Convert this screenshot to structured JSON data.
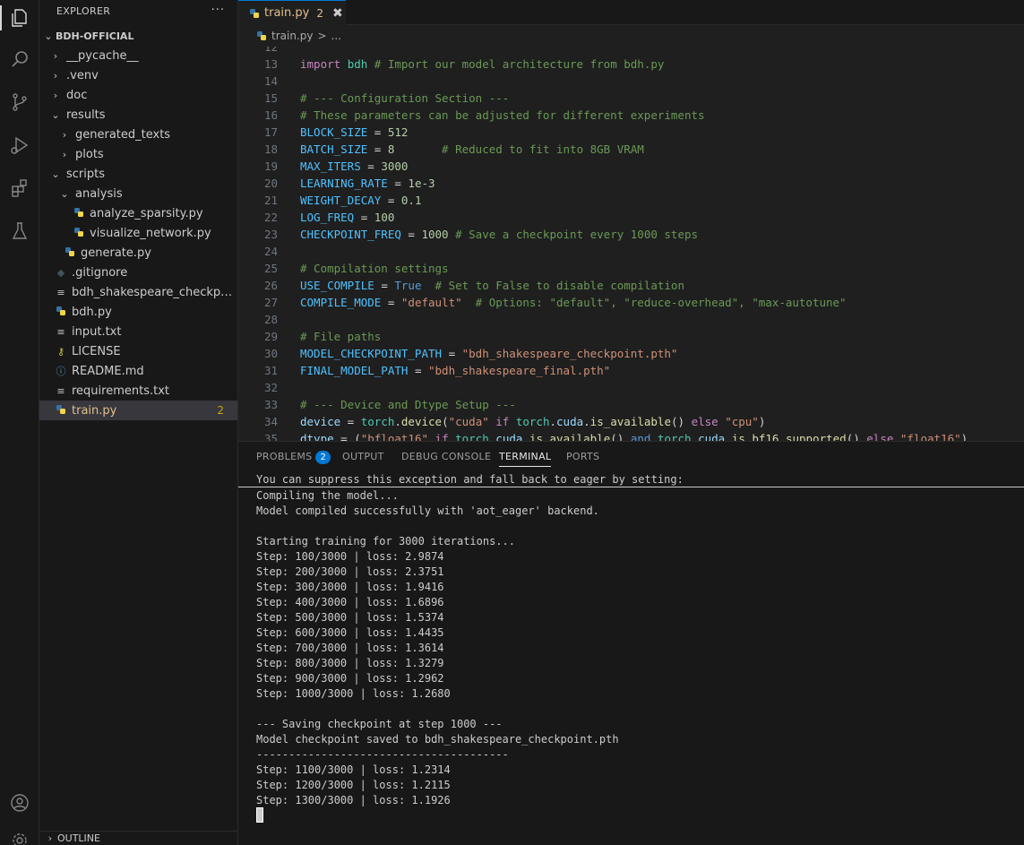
{
  "sidebar": {
    "title": "EXPLORER",
    "more": "···",
    "root": "BDH-OFFICIAL",
    "items": [
      {
        "label": "__pycache__",
        "kind": "folder",
        "depth": 1,
        "open": false
      },
      {
        "label": ".venv",
        "kind": "folder",
        "depth": 1,
        "open": false
      },
      {
        "label": "doc",
        "kind": "folder",
        "depth": 1,
        "open": false
      },
      {
        "label": "results",
        "kind": "folder",
        "depth": 1,
        "open": true
      },
      {
        "label": "generated_texts",
        "kind": "folder",
        "depth": 2,
        "open": false
      },
      {
        "label": "plots",
        "kind": "folder",
        "depth": 2,
        "open": false
      },
      {
        "label": "scripts",
        "kind": "folder",
        "depth": 1,
        "open": true
      },
      {
        "label": "analysis",
        "kind": "folder",
        "depth": 2,
        "open": true
      },
      {
        "label": "analyze_sparsity.py",
        "kind": "py",
        "depth": 3
      },
      {
        "label": "visualize_network.py",
        "kind": "py",
        "depth": 3
      },
      {
        "label": "generate.py",
        "kind": "py",
        "depth": 2
      },
      {
        "label": ".gitignore",
        "kind": "git",
        "depth": 1
      },
      {
        "label": "bdh_shakespeare_checkpoint.pth",
        "kind": "txt",
        "depth": 1
      },
      {
        "label": "bdh.py",
        "kind": "py",
        "depth": 1
      },
      {
        "label": "input.txt",
        "kind": "txt",
        "depth": 1
      },
      {
        "label": "LICENSE",
        "kind": "license",
        "depth": 1
      },
      {
        "label": "README.md",
        "kind": "info",
        "depth": 1
      },
      {
        "label": "requirements.txt",
        "kind": "txt",
        "depth": 1
      },
      {
        "label": "train.py",
        "kind": "py",
        "depth": 1,
        "selected": true,
        "badge": "2"
      }
    ],
    "outline": "OUTLINE"
  },
  "tab": {
    "label": "train.py",
    "badge": "2",
    "close": "✖"
  },
  "breadcrumb": {
    "file": "train.py",
    "sep": ">",
    "more": "..."
  },
  "editor": {
    "lines": [
      {
        "n": "12",
        "tokens": []
      },
      {
        "n": "13",
        "tokens": [
          [
            "import",
            "k-import"
          ],
          [
            " ",
            ""
          ],
          [
            "bdh",
            "k-cls"
          ],
          [
            " # Import our model architecture from bdh.py",
            "k-com"
          ]
        ]
      },
      {
        "n": "14",
        "tokens": []
      },
      {
        "n": "15",
        "tokens": [
          [
            "# --- Configuration Section ---",
            "k-com"
          ]
        ]
      },
      {
        "n": "16",
        "tokens": [
          [
            "# These parameters can be adjusted for different experiments",
            "k-com"
          ]
        ]
      },
      {
        "n": "17",
        "tokens": [
          [
            "BLOCK_SIZE",
            "k-var"
          ],
          [
            " = ",
            "k-op"
          ],
          [
            "512",
            "k-num"
          ]
        ]
      },
      {
        "n": "18",
        "tokens": [
          [
            "BATCH_SIZE",
            "k-var"
          ],
          [
            " = ",
            "k-op"
          ],
          [
            "8",
            "k-num"
          ],
          [
            "       # Reduced to fit into 8GB VRAM",
            "k-com"
          ]
        ]
      },
      {
        "n": "19",
        "tokens": [
          [
            "MAX_ITERS",
            "k-var"
          ],
          [
            " = ",
            "k-op"
          ],
          [
            "3000",
            "k-num"
          ]
        ]
      },
      {
        "n": "20",
        "tokens": [
          [
            "LEARNING_RATE",
            "k-var"
          ],
          [
            " = ",
            "k-op"
          ],
          [
            "1e-3",
            "k-num"
          ]
        ]
      },
      {
        "n": "21",
        "tokens": [
          [
            "WEIGHT_DECAY",
            "k-var"
          ],
          [
            " = ",
            "k-op"
          ],
          [
            "0.1",
            "k-num"
          ]
        ]
      },
      {
        "n": "22",
        "tokens": [
          [
            "LOG_FREQ",
            "k-var"
          ],
          [
            " = ",
            "k-op"
          ],
          [
            "100",
            "k-num"
          ]
        ]
      },
      {
        "n": "23",
        "tokens": [
          [
            "CHECKPOINT_FREQ",
            "k-var"
          ],
          [
            " = ",
            "k-op"
          ],
          [
            "1000",
            "k-num"
          ],
          [
            " # Save a checkpoint every 1000 steps",
            "k-com"
          ]
        ]
      },
      {
        "n": "24",
        "tokens": []
      },
      {
        "n": "25",
        "tokens": [
          [
            "# Compilation settings",
            "k-com"
          ]
        ]
      },
      {
        "n": "26",
        "tokens": [
          [
            "USE_COMPILE",
            "k-var"
          ],
          [
            " = ",
            "k-op"
          ],
          [
            "True",
            "k-bool"
          ],
          [
            "  # Set to False to disable compilation",
            "k-com"
          ]
        ]
      },
      {
        "n": "27",
        "tokens": [
          [
            "COMPILE_MODE",
            "k-var"
          ],
          [
            " = ",
            "k-op"
          ],
          [
            "\"default\"",
            "k-str"
          ],
          [
            "  # Options: \"default\", \"reduce-overhead\", \"max-autotune\"",
            "k-com"
          ]
        ]
      },
      {
        "n": "28",
        "tokens": []
      },
      {
        "n": "29",
        "tokens": [
          [
            "# File paths",
            "k-com"
          ]
        ]
      },
      {
        "n": "30",
        "tokens": [
          [
            "MODEL_CHECKPOINT_PATH",
            "k-var"
          ],
          [
            " = ",
            "k-op"
          ],
          [
            "\"bdh_shakespeare_checkpoint.pth\"",
            "k-str"
          ]
        ]
      },
      {
        "n": "31",
        "tokens": [
          [
            "FINAL_MODEL_PATH",
            "k-var"
          ],
          [
            " = ",
            "k-op"
          ],
          [
            "\"bdh_shakespeare_final.pth\"",
            "k-str"
          ]
        ]
      },
      {
        "n": "32",
        "tokens": []
      },
      {
        "n": "33",
        "tokens": [
          [
            "# --- Device and Dtype Setup ---",
            "k-com"
          ]
        ]
      },
      {
        "n": "34",
        "tokens": [
          [
            "device",
            "k-id"
          ],
          [
            " = ",
            "k-op"
          ],
          [
            "torch",
            "k-cls"
          ],
          [
            ".",
            "k-op"
          ],
          [
            "device",
            "k-fn"
          ],
          [
            "(",
            "k-op"
          ],
          [
            "\"cuda\"",
            "k-str"
          ],
          [
            " if ",
            "k-import"
          ],
          [
            "torch",
            "k-cls"
          ],
          [
            ".",
            "k-op"
          ],
          [
            "cuda",
            "k-id"
          ],
          [
            ".",
            "k-op"
          ],
          [
            "is_available",
            "k-fn"
          ],
          [
            "() ",
            "k-op"
          ],
          [
            "else",
            "k-import"
          ],
          [
            " ",
            ""
          ],
          [
            "\"cpu\"",
            "k-str"
          ],
          [
            ")",
            "k-op"
          ]
        ]
      },
      {
        "n": "35",
        "tokens": [
          [
            "dtype",
            "k-id"
          ],
          [
            " = (",
            "k-op"
          ],
          [
            "\"bfloat16\"",
            "k-str"
          ],
          [
            " if ",
            "k-import"
          ],
          [
            "torch",
            "k-cls"
          ],
          [
            ".",
            "k-op"
          ],
          [
            "cuda",
            "k-id"
          ],
          [
            ".",
            "k-op"
          ],
          [
            "is_available",
            "k-fn"
          ],
          [
            "() ",
            "k-op"
          ],
          [
            "and",
            "k-bool"
          ],
          [
            " ",
            ""
          ],
          [
            "torch",
            "k-cls"
          ],
          [
            ".",
            "k-op"
          ],
          [
            "cuda",
            "k-id"
          ],
          [
            ".",
            "k-op"
          ],
          [
            "is_bf16_supported",
            "k-fn"
          ],
          [
            "() ",
            "k-op"
          ],
          [
            "else",
            "k-import"
          ],
          [
            " ",
            ""
          ],
          [
            "\"float16\"",
            "k-str"
          ],
          [
            ")",
            "k-op"
          ]
        ]
      }
    ]
  },
  "panel": {
    "tabs": [
      {
        "label": "PROBLEMS",
        "badge": "2"
      },
      {
        "label": "OUTPUT"
      },
      {
        "label": "DEBUG CONSOLE"
      },
      {
        "label": "TERMINAL",
        "active": true
      },
      {
        "label": "PORTS"
      }
    ],
    "sticky": "You can suppress this exception and fall back to eager by setting:",
    "terminal": [
      "Compiling the model...",
      "Model compiled successfully with 'aot_eager' backend.",
      "",
      "Starting training for 3000 iterations...",
      "Step: 100/3000 | loss: 2.9874",
      "Step: 200/3000 | loss: 2.3751",
      "Step: 300/3000 | loss: 1.9416",
      "Step: 400/3000 | loss: 1.6896",
      "Step: 500/3000 | loss: 1.5374",
      "Step: 600/3000 | loss: 1.4435",
      "Step: 700/3000 | loss: 1.3614",
      "Step: 800/3000 | loss: 1.3279",
      "Step: 900/3000 | loss: 1.2962",
      "Step: 1000/3000 | loss: 1.2680",
      "",
      "--- Saving checkpoint at step 1000 ---",
      "Model checkpoint saved to bdh_shakespeare_checkpoint.pth",
      "---------------------------------------",
      "Step: 1100/3000 | loss: 1.2314",
      "Step: 1200/3000 | loss: 1.2115",
      "Step: 1300/3000 | loss: 1.1926"
    ]
  }
}
